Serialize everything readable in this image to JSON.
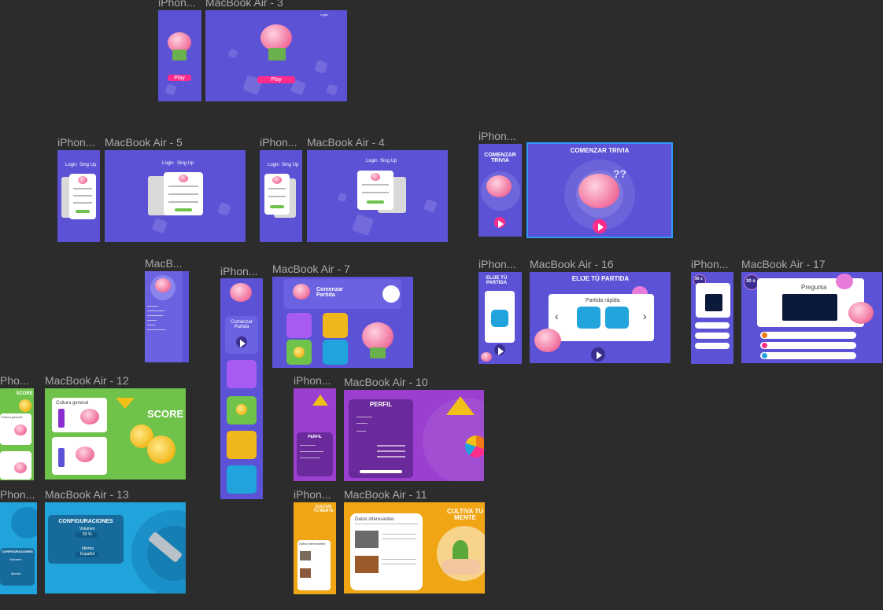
{
  "labels": {
    "f1": "iPhon...",
    "f2": "MacBook Air - 3",
    "f3": "iPhon...",
    "f4": "MacBook Air - 5",
    "f5": "iPhon...",
    "f6": "MacBook Air - 4",
    "f7": "iPhon...",
    "f8": "MacB...",
    "f9": "iPhon...",
    "f10": "MacBook Air - 7",
    "f11": "iPhon...",
    "f12": "MacBook Air - 16",
    "f13": "iPhon...",
    "f14": "MacBook Air - 17",
    "f15": "Pho...",
    "f16": "MacBook Air - 12",
    "f17": "iPhon...",
    "f18": "MacBook Air - 10",
    "f19": "Phon...",
    "f20": "MacBook Air - 13",
    "f21": "iPhon...",
    "f22": "MacBook Air - 11"
  },
  "texts": {
    "play": "Play",
    "login": "Login",
    "signup": "Sing Up",
    "comenzar_trivia": "COMENZAR TRIVIA",
    "comenzar_partida": "Comenzar Partida",
    "elije": "ELIJE TÚ PARTIDA",
    "partida_rapida": "Partida rápida",
    "pregunta": "Pregunta",
    "timer": "30 s",
    "score": "SCORE",
    "cultura_general": "Cultura general",
    "perfil": "PERFIL",
    "configuraciones": "CONFIGURACIONES",
    "volumen": "Volumen",
    "idioma": "Idioma",
    "volume_value": "50 %",
    "language_value": "Español",
    "datos": "Datos interesantes",
    "cultiva": "CULTIVA TU MENTE"
  },
  "colors": {
    "canvas": "#2c2c2c",
    "purple": "#5b52d6",
    "pink": "#ff2c8c",
    "green": "#6fc24a",
    "violet": "#9a3fcf",
    "blue": "#21a3dc",
    "orange": "#f0a514",
    "selection": "#2f9bff"
  }
}
